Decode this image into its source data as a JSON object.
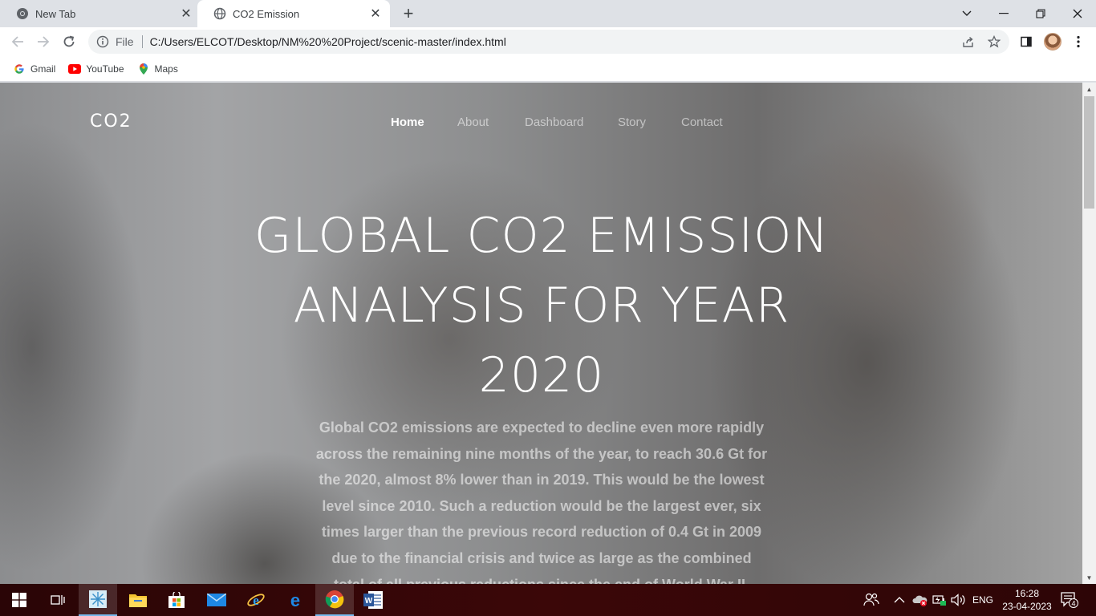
{
  "browser": {
    "tabs": [
      {
        "title": "New Tab",
        "active": false
      },
      {
        "title": "CO2 Emission",
        "active": true
      }
    ],
    "address_bar": {
      "scheme_label": "File",
      "url": "C:/Users/ELCOT/Desktop/NM%20%20Project/scenic-master/index.html"
    },
    "bookmarks": [
      {
        "label": "Gmail",
        "icon": "google-icon"
      },
      {
        "label": "YouTube",
        "icon": "youtube-icon"
      },
      {
        "label": "Maps",
        "icon": "maps-icon"
      }
    ]
  },
  "site": {
    "logo": "CO2",
    "nav": [
      {
        "label": "Home",
        "active": true
      },
      {
        "label": "About",
        "active": false
      },
      {
        "label": "Dashboard",
        "active": false
      },
      {
        "label": "Story",
        "active": false
      },
      {
        "label": "Contact",
        "active": false
      }
    ],
    "hero": {
      "title": "GLOBAL CO2 EMISSION ANALYSIS FOR YEAR 2020",
      "text": "Global CO2 emissions are expected to decline even more rapidly across the remaining nine months of the year, to reach 30.6 Gt for the 2020, almost 8% lower than in 2019. This would be the lowest level since 2010. Such a reduction would be the largest ever, six times larger than the previous record reduction of 0.4 Gt in 2009 due to the financial crisis and twice as large as the combined total of all previous reductions since the end of World War II."
    }
  },
  "taskbar": {
    "language": "ENG",
    "time": "16:28",
    "date": "23-04-2023",
    "notification_count": "4"
  },
  "colors": {
    "tab_strip": "#dee1e6",
    "taskbar": "#3b0708",
    "hero_text": "#ffffff"
  }
}
